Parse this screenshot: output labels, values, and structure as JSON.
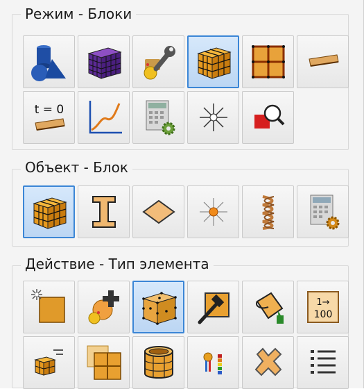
{
  "groups": {
    "mode": {
      "title": "Режим - Блоки"
    },
    "object": {
      "title": "Объект - Блок"
    },
    "action": {
      "title": "Действие - Тип элемента"
    }
  },
  "icons": {
    "t0_label": "t = 0",
    "numbering_top": "1→",
    "numbering_bottom": "100"
  }
}
